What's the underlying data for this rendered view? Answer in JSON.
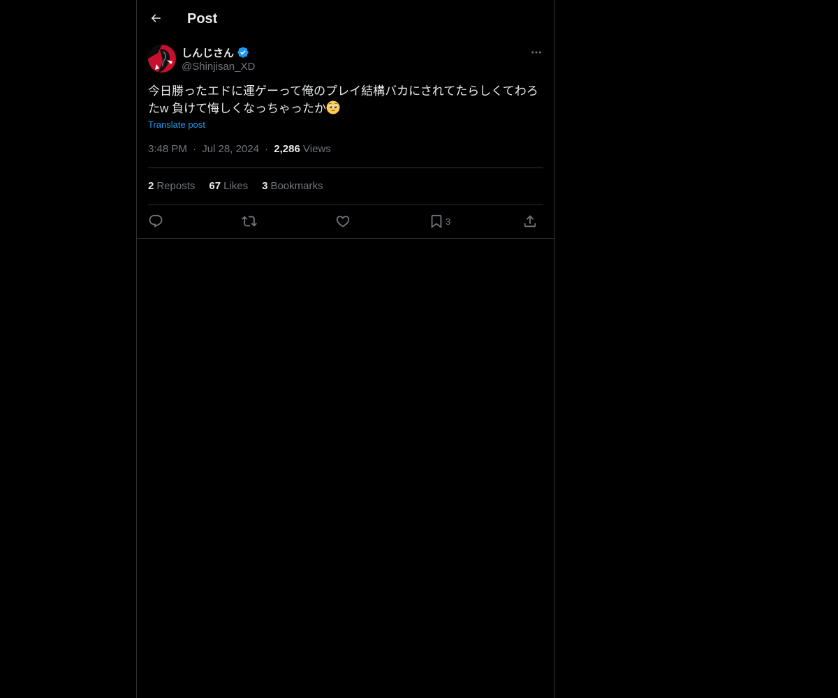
{
  "header": {
    "title": "Post"
  },
  "author": {
    "name": "しんじさん",
    "handle": "@Shinjisan_XD",
    "verified": true
  },
  "post": {
    "text": "今日勝ったエドに運ゲーって俺のプレイ結構バカにされてたらしくてわろたw 負けて悔しくなっちゃったか",
    "emoji": "pleading-face-emoji",
    "translate_label": "Translate post",
    "time": "3:48 PM",
    "date": "Jul 28, 2024",
    "separator": "·",
    "views_count": "2,286",
    "views_label": "Views"
  },
  "stats": {
    "reposts_count": "2",
    "reposts_label": "Reposts",
    "likes_count": "67",
    "likes_label": "Likes",
    "bookmarks_count": "3",
    "bookmarks_label": "Bookmarks"
  },
  "actions": {
    "reply_icon": "reply-icon",
    "repost_icon": "repost-icon",
    "like_icon": "heart-icon",
    "bookmark_icon": "bookmark-icon",
    "bookmark_count": "3",
    "share_icon": "share-icon"
  },
  "colors": {
    "background": "#000000",
    "text": "#e7e9ea",
    "secondary": "#71767b",
    "accent": "#1d9bf0",
    "border": "#2f3336"
  }
}
